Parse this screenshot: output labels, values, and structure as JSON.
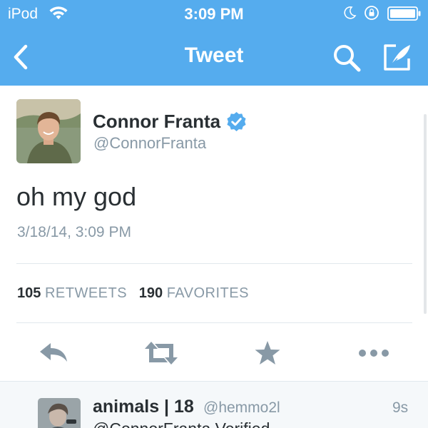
{
  "status_bar": {
    "carrier": "iPod",
    "time": "3:09 PM"
  },
  "nav": {
    "title": "Tweet"
  },
  "tweet": {
    "author_name": "Connor Franta",
    "author_handle": "@ConnorFranta",
    "text": "oh my god",
    "timestamp": "3/18/14, 3:09 PM",
    "retweets_count": "105",
    "retweets_label": "RETWEETS",
    "favorites_count": "190",
    "favorites_label": "FAVORITES"
  },
  "reply": {
    "author_name": "animals | 18",
    "author_handle": "@hemmo2l",
    "age": "9s",
    "text_partial": "@ConnorFranta Verified"
  },
  "colors": {
    "header_bg": "#55acee",
    "verified_badge": "#55acee",
    "action_icon": "#8899a6",
    "secondary_text": "#8899a6"
  },
  "icons": {
    "back": "chevron-left-icon",
    "search": "search-icon",
    "compose": "compose-icon",
    "reply": "reply-icon",
    "retweet": "retweet-icon",
    "favorite": "star-icon",
    "more": "more-icon"
  }
}
